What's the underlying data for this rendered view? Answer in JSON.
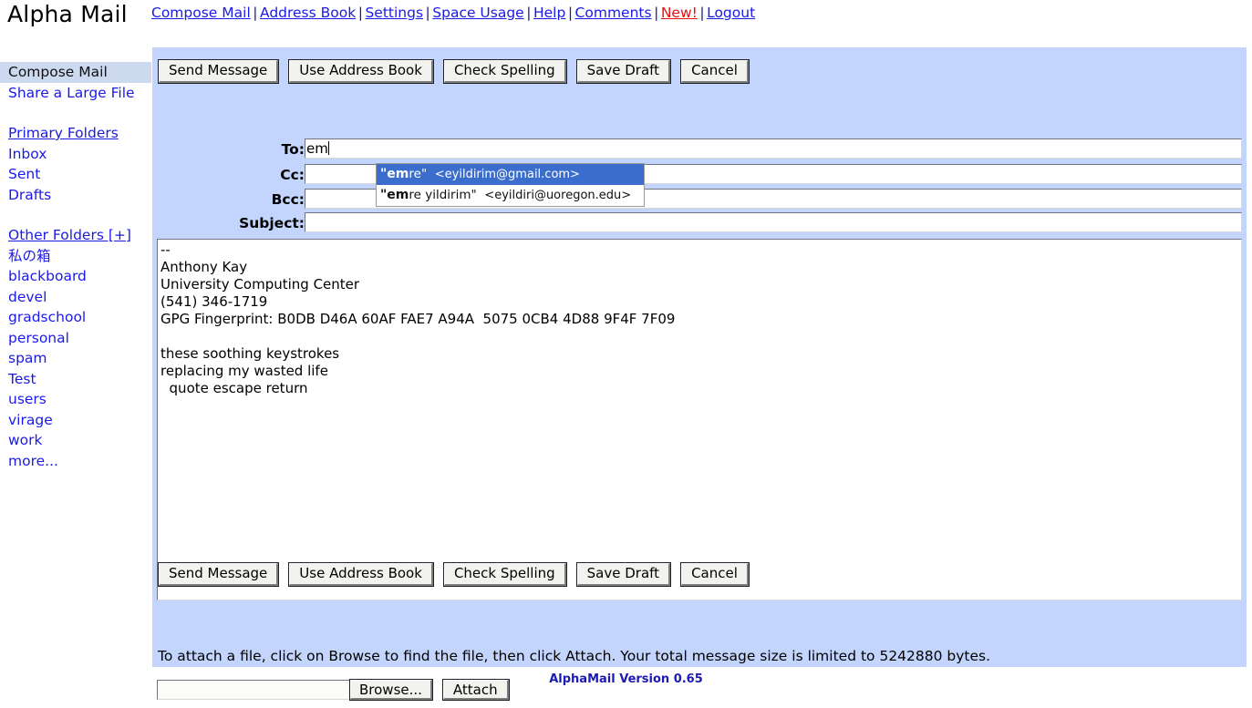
{
  "brand": "Alpha Mail",
  "topnav": {
    "items": [
      {
        "label": "Compose Mail",
        "style": "link"
      },
      {
        "label": "Address Book",
        "style": "link"
      },
      {
        "label": "Settings",
        "style": "link"
      },
      {
        "label": "Space Usage",
        "style": "link"
      },
      {
        "label": "Help",
        "style": "link"
      },
      {
        "label": "Comments",
        "style": "link"
      },
      {
        "label": "New!",
        "style": "alert"
      },
      {
        "label": "Logout",
        "style": "link"
      }
    ],
    "separator": "|"
  },
  "sidebar": {
    "top": [
      {
        "label": "Compose Mail",
        "current": true
      },
      {
        "label": "Share a Large File",
        "current": false
      }
    ],
    "primary_heading": "Primary Folders",
    "primary": [
      {
        "label": "Inbox"
      },
      {
        "label": "Sent"
      },
      {
        "label": "Drafts"
      }
    ],
    "other_heading": "Other Folders [+]",
    "other": [
      {
        "label": "私の箱"
      },
      {
        "label": "blackboard"
      },
      {
        "label": "devel"
      },
      {
        "label": "gradschool"
      },
      {
        "label": "personal"
      },
      {
        "label": "spam"
      },
      {
        "label": "Test"
      },
      {
        "label": "users"
      },
      {
        "label": "virage"
      },
      {
        "label": "work"
      },
      {
        "label": "more..."
      }
    ]
  },
  "toolbar": {
    "buttons": [
      {
        "label": "Send Message"
      },
      {
        "label": "Use Address Book"
      },
      {
        "label": "Check Spelling"
      },
      {
        "label": "Save Draft"
      },
      {
        "label": "Cancel"
      }
    ]
  },
  "compose": {
    "fields": [
      {
        "label": "To:",
        "value": "em",
        "has_caret": true
      },
      {
        "label": "Cc:",
        "value": "",
        "has_caret": false
      },
      {
        "label": "Bcc:",
        "value": "",
        "has_caret": false
      },
      {
        "label": "Subject:",
        "value": "",
        "has_caret": false
      }
    ],
    "body": "--\nAnthony Kay\nUniversity Computing Center\n(541) 346-1719\nGPG Fingerprint: B0DB D46A 60AF FAE7 A94A  5075 0CB4 4D88 9F4F 7F09\n\nthese soothing keystrokes\nreplacing my wasted life\n  quote escape return"
  },
  "autocomplete": {
    "query": "em",
    "items": [
      {
        "prefix": "\"em",
        "rest": "re\"",
        "address": "<eyildirim@gmail.com>",
        "selected": true
      },
      {
        "prefix": "\"em",
        "rest": "re yildirim\"",
        "address": "<eyildiri@uoregon.edu>",
        "selected": false
      }
    ],
    "selected_color": "#3b6ecc"
  },
  "attach": {
    "note": "To attach a file, click on Browse to find the file, then click Attach. Your total message size is limited to 5242880 bytes.",
    "file_value": "",
    "browse_label": "Browse...",
    "attach_label": "Attach"
  },
  "footer": {
    "version": "AlphaMail Version 0.65"
  },
  "colors": {
    "panel_bg": "#c3d5fd",
    "link": "#1a1ae6",
    "alert": "#e81010",
    "footer": "#1b1bb4",
    "sidebar_current_bg": "#ccd9ee"
  }
}
